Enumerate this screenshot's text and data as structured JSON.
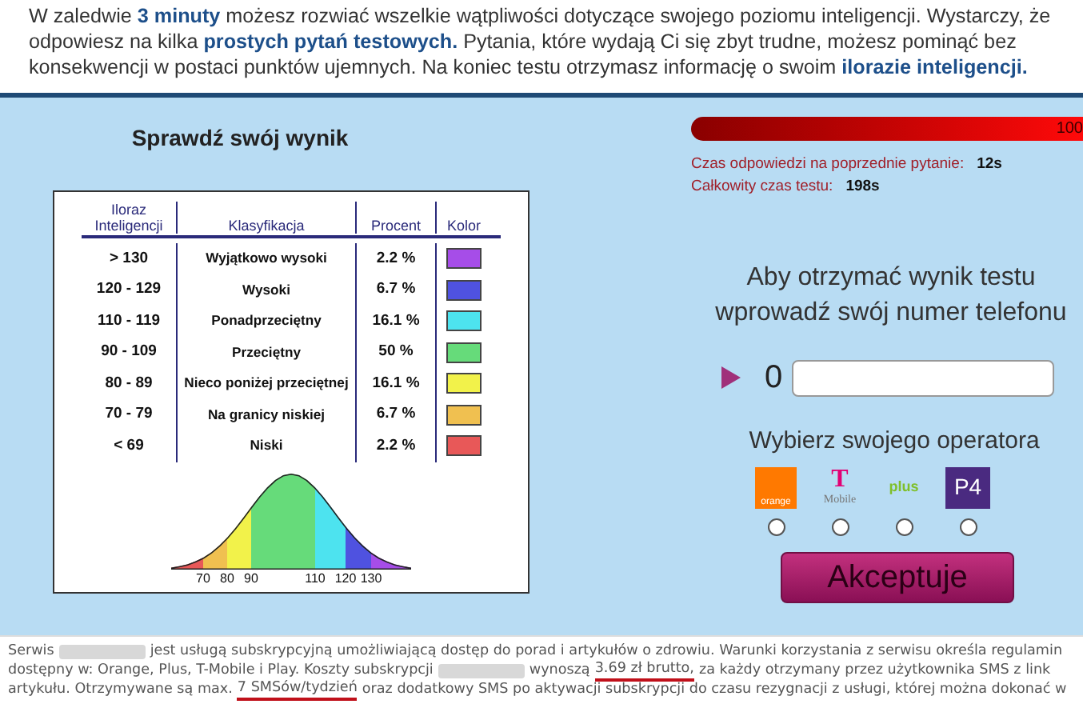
{
  "intro": "W zaledwie **3 minuty** możesz rozwiać wszelkie wątpliwości dotyczące swojego poziomu inteligencji. Wystarczy, że odpowiesz na kilka **prostych pytań testowych.** Pytania, które wydają Ci się zbyt trudne, możesz pominąć bez konsekwencji w postaci punktów ujemnych. Na koniec testu otrzymasz informację o swoim **ilorazie inteligencji.**",
  "result_title": "Sprawdź swój wynik",
  "table": {
    "columns": [
      "Iloraz Inteligencji",
      "Klasyfikacja",
      "Procent",
      "Kolor"
    ],
    "rows": [
      {
        "range": "> 130",
        "class": "Wyjątkowo wysoki",
        "percent": "2.2 %",
        "color": "#a64de8"
      },
      {
        "range": "120 - 129",
        "class": "Wysoki",
        "percent": "6.7 %",
        "color": "#4f52e0"
      },
      {
        "range": "110 - 119",
        "class": "Ponadprzeciętny",
        "percent": "16.1 %",
        "color": "#4de3ef"
      },
      {
        "range": "90 - 109",
        "class": "Przeciętny",
        "percent": "50 %",
        "color": "#66db7a"
      },
      {
        "range": "80 - 89",
        "class": "Nieco poniżej przeciętnej",
        "percent": "16.1 %",
        "color": "#f2f24a"
      },
      {
        "range": "70 - 79",
        "class": "Na granicy niskiej",
        "percent": "6.7 %",
        "color": "#f0c050"
      },
      {
        "range": "< 69",
        "class": "Niski",
        "percent": "2.2 %",
        "color": "#e85858"
      }
    ],
    "curve_ticks": [
      "70",
      "80",
      "90",
      "110",
      "120",
      "130"
    ]
  },
  "progress": {
    "level": 1,
    "reading": "100"
  },
  "times": [
    {
      "label": "Czas odpowiedzi na poprzednie pytanie:",
      "value": "12s"
    },
    {
      "label": "Całkowity czas testu:",
      "value": "198s"
    }
  ],
  "phone_prompt": "Aby otrzymać wynik testu wprowadź swój numer telefonu",
  "phone_prefix": "0",
  "operator_prompt": "Wybierz swojego operatora",
  "operators": [
    {
      "kind": "orange",
      "label": "orange",
      "selected": false
    },
    {
      "kind": "tmobile",
      "mark": "T",
      "label": "Mobile",
      "selected": false
    },
    {
      "kind": "plus",
      "label": "plus",
      "selected": false
    },
    {
      "kind": "p4",
      "label": "P4",
      "selected": false
    }
  ],
  "accept_button": "Akceptuje",
  "footer": [
    [
      {
        "kind": "text",
        "text": "Serwis"
      },
      {
        "kind": "blur"
      },
      {
        "kind": "text",
        "text": "jest usługą subskrypcyjną umożliwiającą dostęp do porad i artykułów o zdrowiu. Warunki korzystania z serwisu określa regulamin"
      }
    ],
    [
      {
        "kind": "text",
        "text": "dostępny w: Orange, Plus, T-Mobile i Play. Koszty subskrypcji"
      },
      {
        "kind": "blur"
      },
      {
        "kind": "text",
        "text": "wynoszą"
      },
      {
        "kind": "underlined",
        "text": "3.69 zł brutto,"
      },
      {
        "kind": "text",
        "text": "za każdy otrzymany przez użytkownika SMS z link"
      }
    ],
    [
      {
        "kind": "text",
        "text": "artykułu. Otrzymywane są max."
      },
      {
        "kind": "underlined",
        "text": "7 SMSów/tydzień"
      },
      {
        "kind": "text",
        "text": "oraz dodatkowy SMS po aktywacji subskrypcji do czasu rezygnacji z usługi, której można dokonać w"
      }
    ]
  ]
}
